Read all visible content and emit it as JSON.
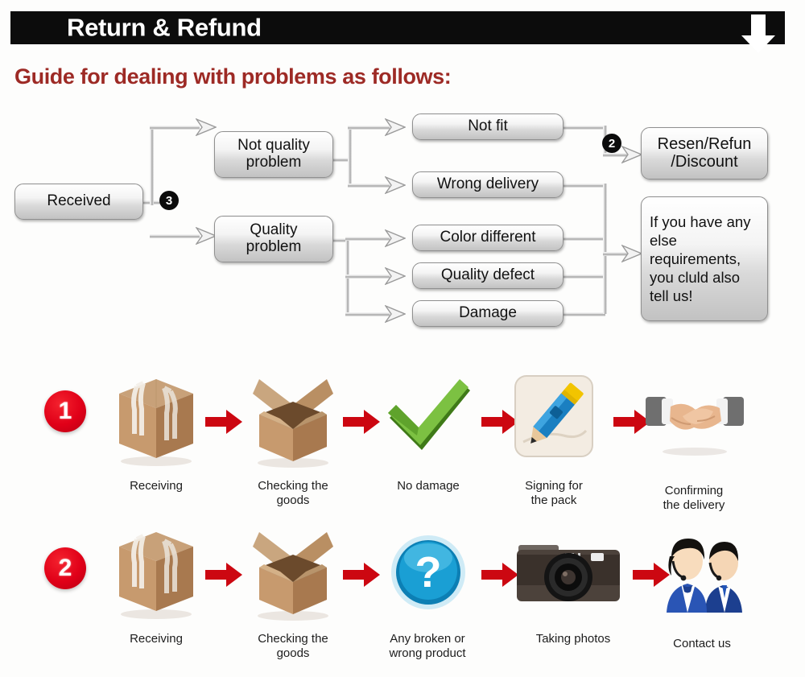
{
  "header": {
    "title": "Return & Refund",
    "arrow_icon": "down-arrow-icon",
    "bar_color": "#0c0c0c",
    "text_color": "#ffffff"
  },
  "guide": {
    "title": "Guide for dealing with problems as follows:",
    "color": "#9d2a25"
  },
  "flowchart": {
    "type": "flow-diagram",
    "nodes": [
      {
        "id": "received",
        "label": "Received"
      },
      {
        "id": "not-quality",
        "label": "Not quality\nproblem"
      },
      {
        "id": "quality",
        "label": "Quality\nproblem"
      },
      {
        "id": "not-fit",
        "label": "Not fit"
      },
      {
        "id": "wrong-delivery",
        "label": "Wrong delivery"
      },
      {
        "id": "color-different",
        "label": "Color different"
      },
      {
        "id": "quality-defect",
        "label": "Quality defect"
      },
      {
        "id": "damage",
        "label": "Damage"
      },
      {
        "id": "resend",
        "label": "Resen/Refun\n/Discount"
      },
      {
        "id": "else",
        "label": "If you have any else requirements, you cluld also tell us!"
      }
    ],
    "badges": [
      {
        "id": "badge-3",
        "label": "❶"
      },
      {
        "id": "badge-2",
        "label": "❵"
      }
    ],
    "badge_values": {
      "branch_three": "3",
      "branch_two": "2"
    }
  },
  "step_rows": [
    {
      "number": "1",
      "steps": [
        {
          "icon": "closed-box-icon",
          "caption": "Receiving"
        },
        {
          "icon": "open-box-icon",
          "caption": "Checking the\ngoods"
        },
        {
          "icon": "green-check-icon",
          "caption": "No damage"
        },
        {
          "icon": "pencil-sign-icon",
          "caption": "Signing for\nthe pack"
        },
        {
          "icon": "handshake-icon",
          "caption": "Confirming\nthe delivery"
        }
      ]
    },
    {
      "number": "2",
      "steps": [
        {
          "icon": "closed-box-icon",
          "caption": "Receiving"
        },
        {
          "icon": "open-box-icon",
          "caption": "Checking the\ngoods"
        },
        {
          "icon": "question-orb-icon",
          "caption": "Any broken or\nwrong product"
        },
        {
          "icon": "camera-icon",
          "caption": "Taking photos"
        },
        {
          "icon": "support-agents-icon",
          "caption": "Contact us"
        }
      ]
    }
  ],
  "colors": {
    "background": "#fdfdfc",
    "accent_red": "#e00018",
    "arrow_red": "#cc0711",
    "heading_red": "#9d2a25",
    "box_border": "#8f8f8f",
    "connector_grey": "#9c9c9c"
  }
}
